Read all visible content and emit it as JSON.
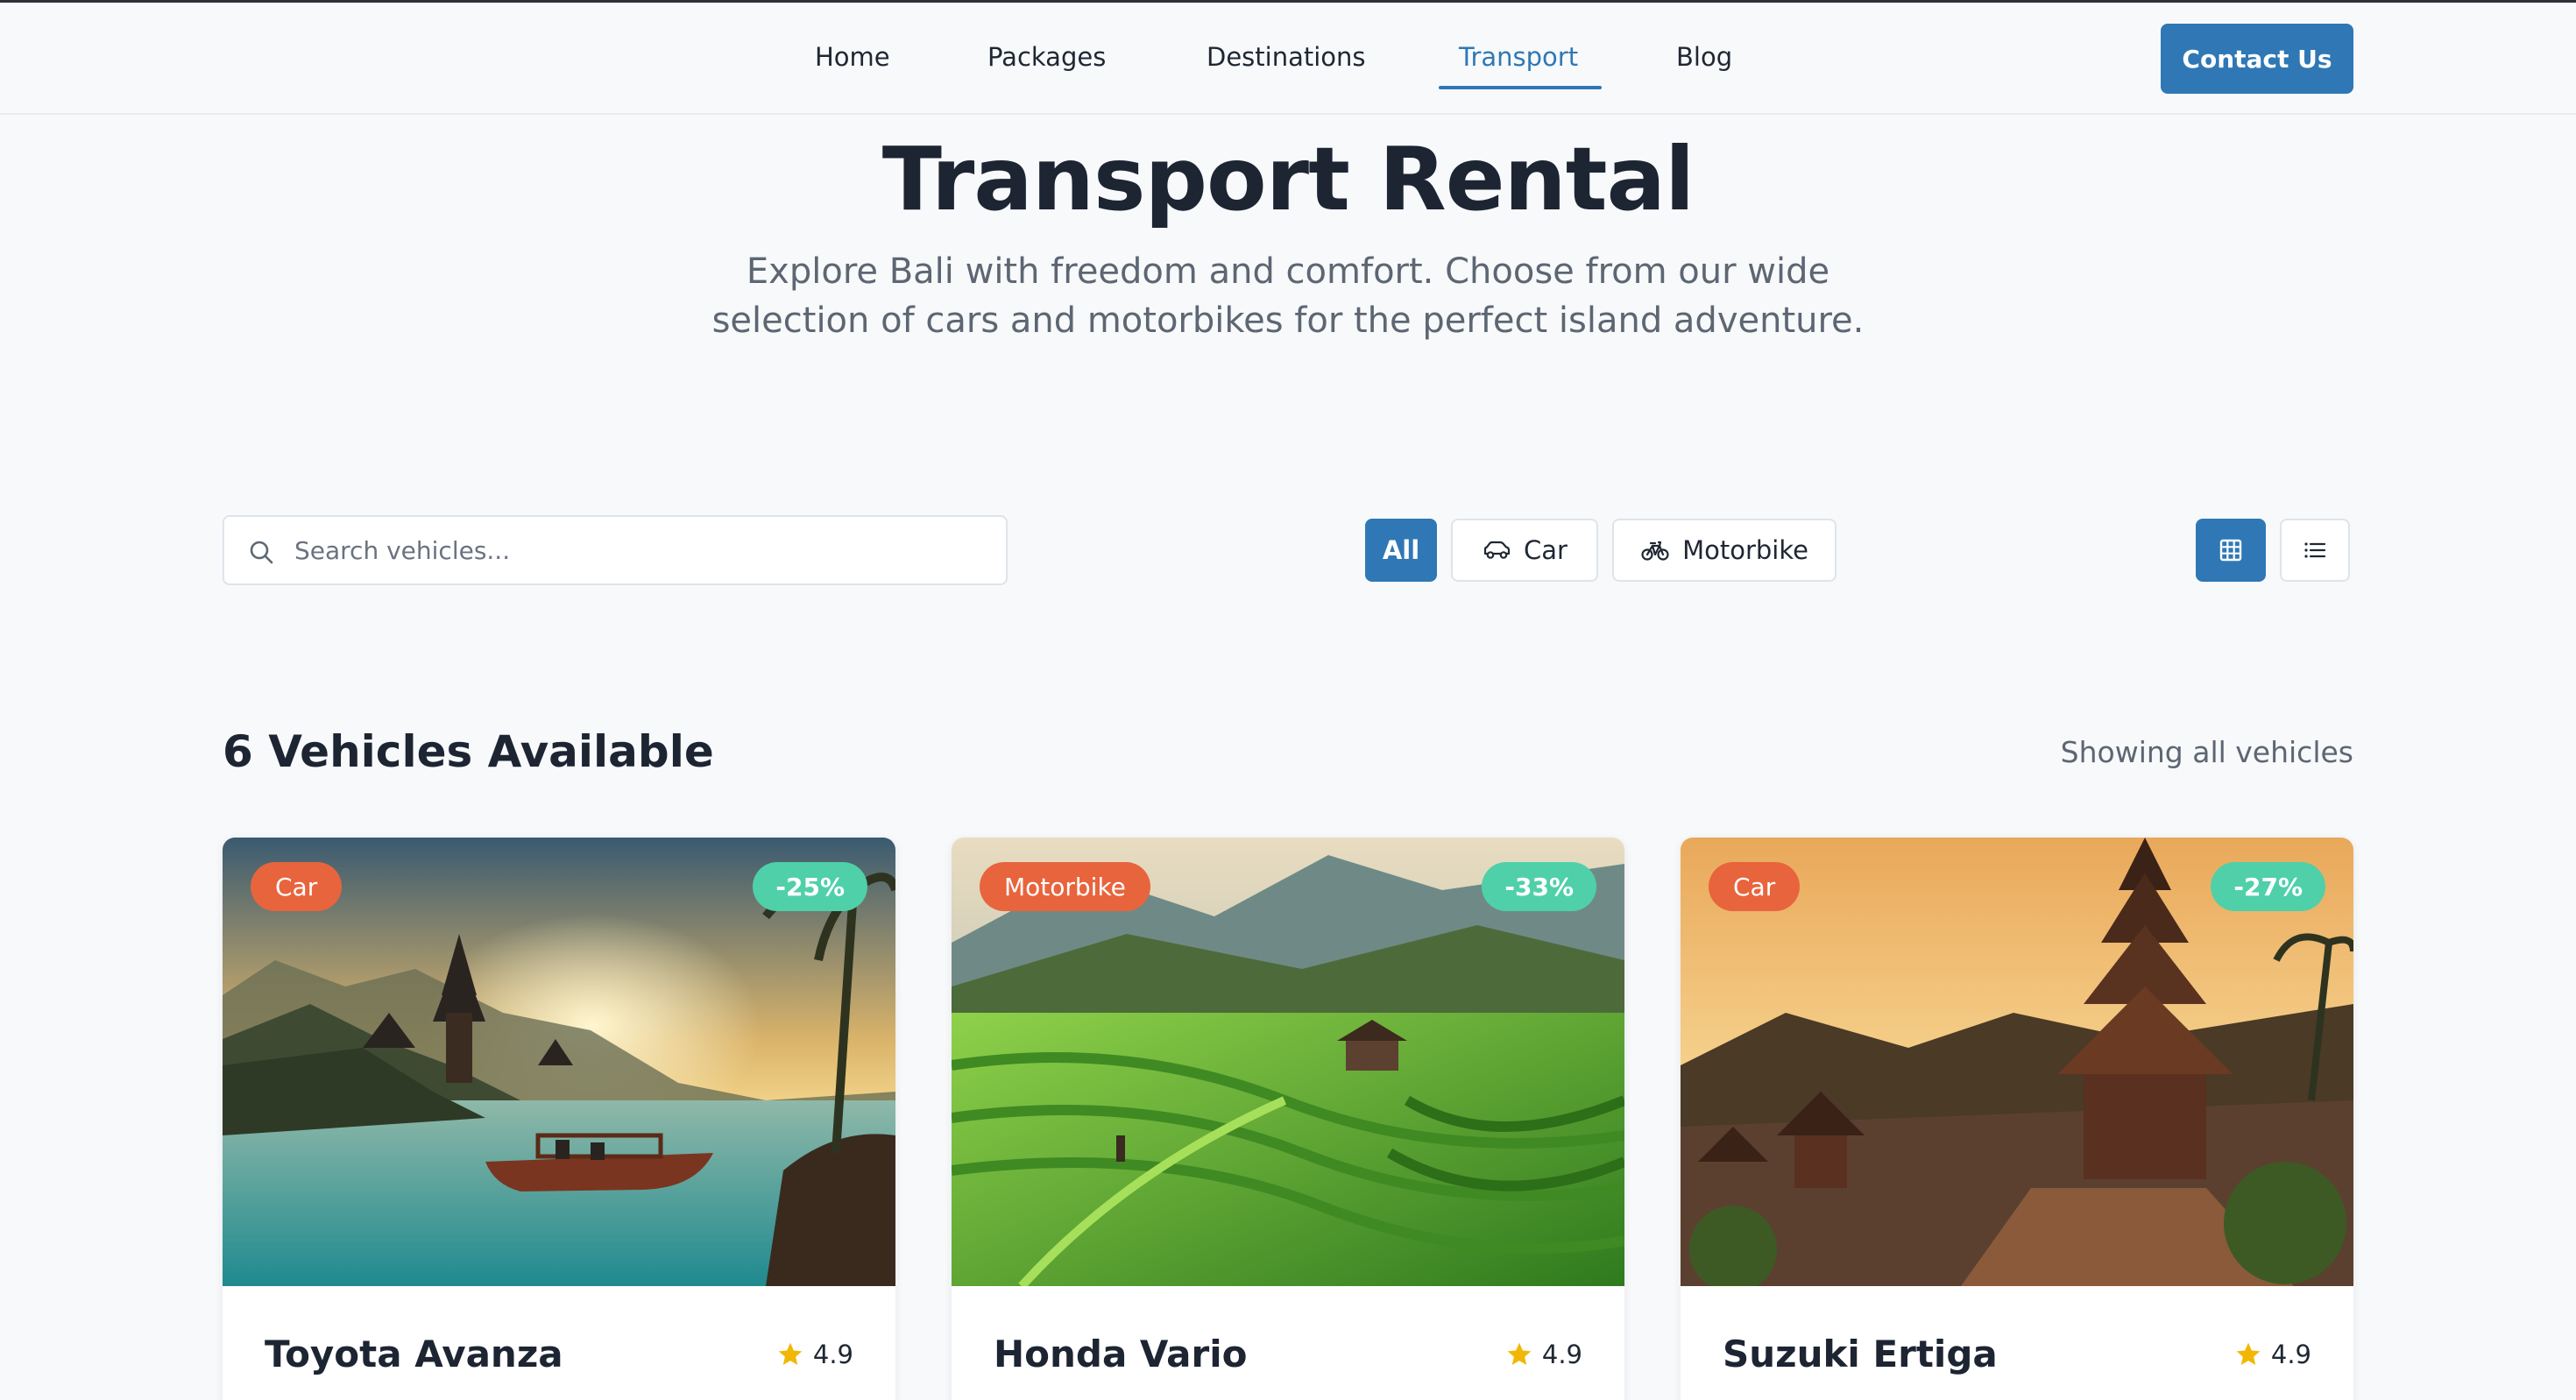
{
  "nav": {
    "items": [
      {
        "label": "Home"
      },
      {
        "label": "Packages"
      },
      {
        "label": "Destinations"
      },
      {
        "label": "Transport",
        "active": true
      },
      {
        "label": "Blog"
      }
    ],
    "contact_label": "Contact Us"
  },
  "hero": {
    "title": "Transport Rental",
    "subtitle_line1": "Explore Bali with freedom and comfort. Choose from our wide",
    "subtitle_line2": "selection of cars and motorbikes for the perfect island adventure."
  },
  "search": {
    "placeholder": "Search vehicles...",
    "value": ""
  },
  "filters": {
    "all": "All",
    "car": "Car",
    "motorbike": "Motorbike",
    "selected": "All"
  },
  "view": {
    "selected": "grid"
  },
  "results": {
    "count_label": "6 Vehicles Available",
    "note": "Showing all vehicles"
  },
  "vehicles": [
    {
      "type": "Car",
      "discount": "-25%",
      "name": "Toyota Avanza",
      "rating": "4.9",
      "image": "sunset-lake-temple-boat-photo"
    },
    {
      "type": "Motorbike",
      "discount": "-33%",
      "name": "Honda Vario",
      "rating": "4.9",
      "image": "rice-terraces-photo"
    },
    {
      "type": "Car",
      "discount": "-27%",
      "name": "Suzuki Ertiga",
      "rating": "4.9",
      "image": "pagoda-temple-sunset-photo"
    }
  ],
  "colors": {
    "accent": "#2f78b5",
    "type_badge": "#e8643d",
    "discount_badge": "#4fd0a9",
    "star": "#f2b705",
    "background": "#f7f9fb"
  }
}
